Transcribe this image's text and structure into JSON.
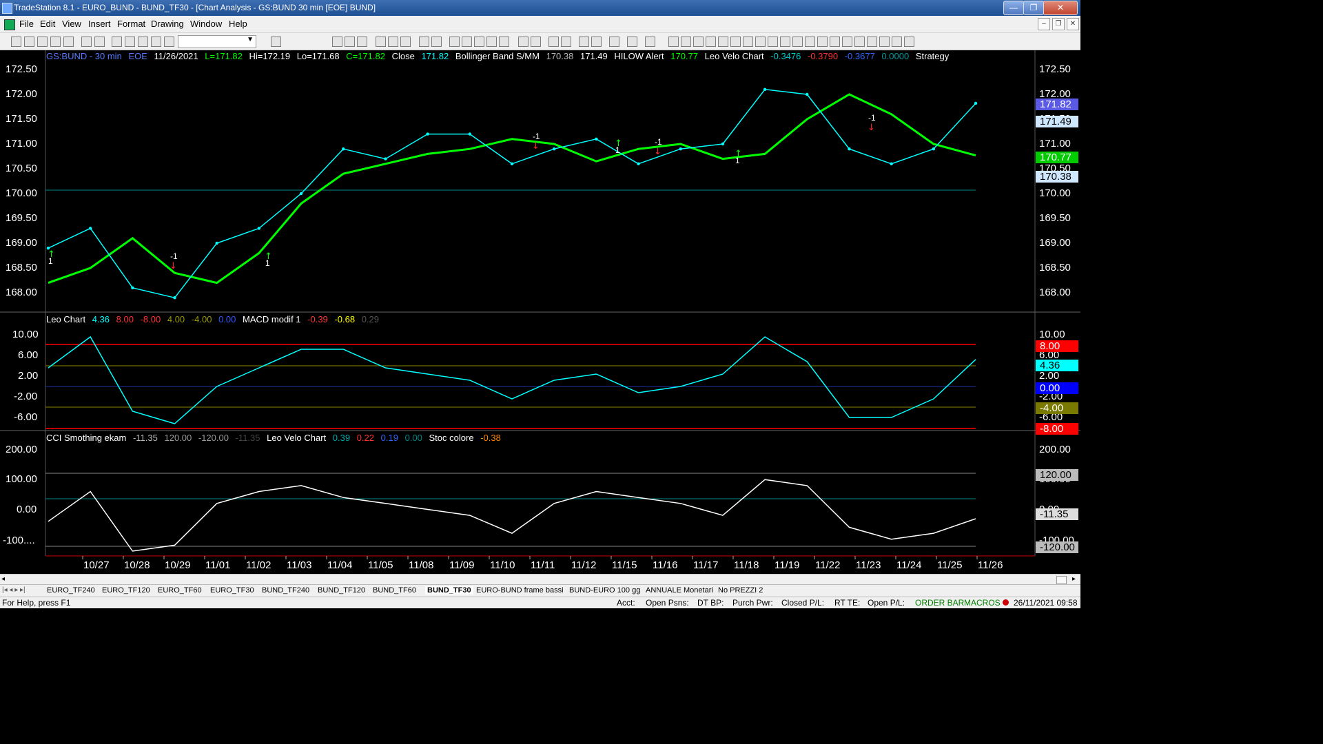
{
  "window": {
    "title": "TradeStation 8.1 - EURO_BUND - BUND_TF30 - [Chart Analysis - GS:BUND  30 min  [EOE] BUND]",
    "minimize": "—",
    "maximize": "❐",
    "close": "✕"
  },
  "menu": [
    "File",
    "Edit",
    "View",
    "Insert",
    "Format",
    "Drawing",
    "Window",
    "Help"
  ],
  "mdi": {
    "minimize": "–",
    "restore": "❐",
    "close": "✕"
  },
  "chart": {
    "symbol_label": "GS:BUND - 30 min",
    "session": "EOE",
    "date": "11/26/2021",
    "last": "L=171.82",
    "high": "Hi=172.19",
    "low": "Lo=171.68",
    "close_val": "C=171.82",
    "close_label": "Close",
    "close_num": "171.82",
    "bb_label": "Bollinger Band S/MM",
    "bb_v1": "170.38",
    "bb_v2": "171.49",
    "hilow_label": "HILOW Alert",
    "hilow_v": "170.77",
    "leovelo_label": "Leo Velo Chart",
    "lv1": "-0.3476",
    "lv2": "-0.3790",
    "lv3": "-0.3677",
    "lv4": "0.0000",
    "strategy_label": "Strategy"
  },
  "panel2": {
    "leo_label": "Leo Chart",
    "v1": "4.36",
    "v2": "8.00",
    "v3": "-8.00",
    "v4": "4.00",
    "v5": "-4.00",
    "v6": "0.00",
    "macd_label": "MACD modif 1",
    "m1": "-0.39",
    "m2": "-0.68",
    "m3": "0.29"
  },
  "panel3": {
    "cci_label": "CCI Smothing ekam",
    "c1": "-11.35",
    "c2": "120.00",
    "c3": "-120.00",
    "c4": "-11.35",
    "lvc_label": "Leo Velo Chart",
    "l1": "0.39",
    "l2": "0.22",
    "l3": "0.19",
    "l4": "0.00",
    "stoc_label": "Stoc colore",
    "s1": "-0.38"
  },
  "y_axis_main": [
    "172.50",
    "172.00",
    "171.50",
    "171.00",
    "170.50",
    "170.00",
    "169.50",
    "169.00",
    "168.50",
    "168.00"
  ],
  "y_axis_p2": [
    "10.00",
    "6.00",
    "2.00",
    "-2.00",
    "-6.00"
  ],
  "y_axis_p3": [
    "200.00",
    "100.00",
    "0.00",
    "-100...."
  ],
  "right_axis_main": [
    "172.50",
    "172.00",
    "171.50",
    "171.00",
    "170.50",
    "170.00",
    "169.50",
    "169.00",
    "168.50",
    "168.00"
  ],
  "right_axis_p2": [
    "10.00",
    "6.00",
    "2.00",
    "-2.00",
    "-6.00"
  ],
  "right_axis_p3": [
    "200.00",
    "100.00",
    "0.00",
    "-100.00"
  ],
  "tags_main": [
    {
      "text": "171.82",
      "bg": "#5a5ae6",
      "fg": "#ffffff"
    },
    {
      "text": "171.49",
      "bg": "#cfe8ff",
      "fg": "#000000"
    },
    {
      "text": "170.77",
      "bg": "#00cc00",
      "fg": "#ffffff"
    },
    {
      "text": "170.38",
      "bg": "#cfe8ff",
      "fg": "#000000"
    }
  ],
  "tags_p2": [
    {
      "text": "8.00",
      "bg": "#ff0000",
      "fg": "#ffffff"
    },
    {
      "text": "4.36",
      "bg": "#00ffff",
      "fg": "#000000"
    },
    {
      "text": "0.00",
      "bg": "#0000ff",
      "fg": "#ffffff"
    },
    {
      "text": "-4.00",
      "bg": "#7a7a00",
      "fg": "#ffffff"
    },
    {
      "text": "-8.00",
      "bg": "#ff0000",
      "fg": "#ffffff"
    }
  ],
  "tags_p3": [
    {
      "text": "120.00",
      "bg": "#bbbbbb",
      "fg": "#000000"
    },
    {
      "text": "-11.35",
      "bg": "#dddddd",
      "fg": "#000000"
    },
    {
      "text": "-120.00",
      "bg": "#bbbbbb",
      "fg": "#000000"
    }
  ],
  "signals": {
    "buy": "1",
    "sell": "-1"
  },
  "x_axis": [
    "10/27",
    "10/28",
    "10/29",
    "11/01",
    "11/02",
    "11/03",
    "11/04",
    "11/05",
    "11/08",
    "11/09",
    "11/10",
    "11/11",
    "11/12",
    "11/15",
    "11/16",
    "11/17",
    "11/18",
    "11/19",
    "11/22",
    "11/23",
    "11/24",
    "11/25",
    "11/26"
  ],
  "tabs": [
    "EURO_TF240",
    "EURO_TF120",
    "EURO_TF60",
    "EURO_TF30",
    "BUND_TF240",
    "BUND_TF120",
    "BUND_TF60",
    "BUND_TF30",
    "EURO-BUND frame bassi",
    "BUND-EURO 100 gg",
    "ANNUALE Monetari",
    "No PREZZI 2"
  ],
  "status": {
    "help": "For Help, press F1",
    "acct": "Acct:",
    "open_psns": "Open Psns:",
    "dt_bp": "DT BP:",
    "purch_pwr": "Purch Pwr:",
    "closed_pl": "Closed P/L:",
    "rt_te": "RT TE:",
    "open_pl": "Open P/L:",
    "order_bar": "ORDER BAR",
    "macros": "MACROS",
    "datetime": "26/11/2021 09:58"
  },
  "chart_data": {
    "type": "line",
    "categories": [
      "10/27",
      "10/28",
      "10/29",
      "11/01",
      "11/02",
      "11/03",
      "11/04",
      "11/05",
      "11/08",
      "11/09",
      "11/10",
      "11/11",
      "11/12",
      "11/15",
      "11/16",
      "11/17",
      "11/18",
      "11/19",
      "11/22",
      "11/23",
      "11/24",
      "11/25",
      "11/26"
    ],
    "series": [
      {
        "name": "Close",
        "color": "#00ffff",
        "values": [
          168.9,
          169.3,
          168.1,
          167.9,
          169.0,
          169.3,
          170.0,
          170.9,
          170.7,
          171.2,
          171.2,
          170.6,
          170.9,
          171.1,
          170.6,
          170.9,
          171.0,
          172.1,
          172.0,
          170.9,
          170.6,
          170.9,
          171.82
        ]
      },
      {
        "name": "HILOW Alert",
        "color": "#00ff00",
        "values": [
          168.2,
          168.5,
          169.1,
          168.4,
          168.2,
          168.8,
          169.8,
          170.4,
          170.6,
          170.8,
          170.9,
          171.1,
          171.0,
          170.65,
          170.9,
          171.0,
          170.7,
          170.8,
          171.5,
          172.0,
          171.6,
          171.0,
          170.77
        ]
      },
      {
        "name": "Leo Chart",
        "color": "#00ffff",
        "values": [
          3,
          8,
          -4,
          -6,
          0,
          3,
          6,
          6,
          3,
          2,
          1,
          -2,
          1,
          2,
          -1,
          0,
          2,
          8,
          4,
          -5,
          -5,
          -2,
          4.36
        ]
      },
      {
        "name": "CCI Smothing ekam",
        "color": "#ffffff",
        "values": [
          -20,
          80,
          -120,
          -100,
          40,
          80,
          100,
          60,
          40,
          20,
          0,
          -60,
          40,
          80,
          60,
          40,
          0,
          120,
          100,
          -40,
          -80,
          -60,
          -11.35
        ]
      }
    ],
    "xlabel": "",
    "ylabel": "",
    "ylim_main": [
      168.0,
      172.5
    ]
  }
}
